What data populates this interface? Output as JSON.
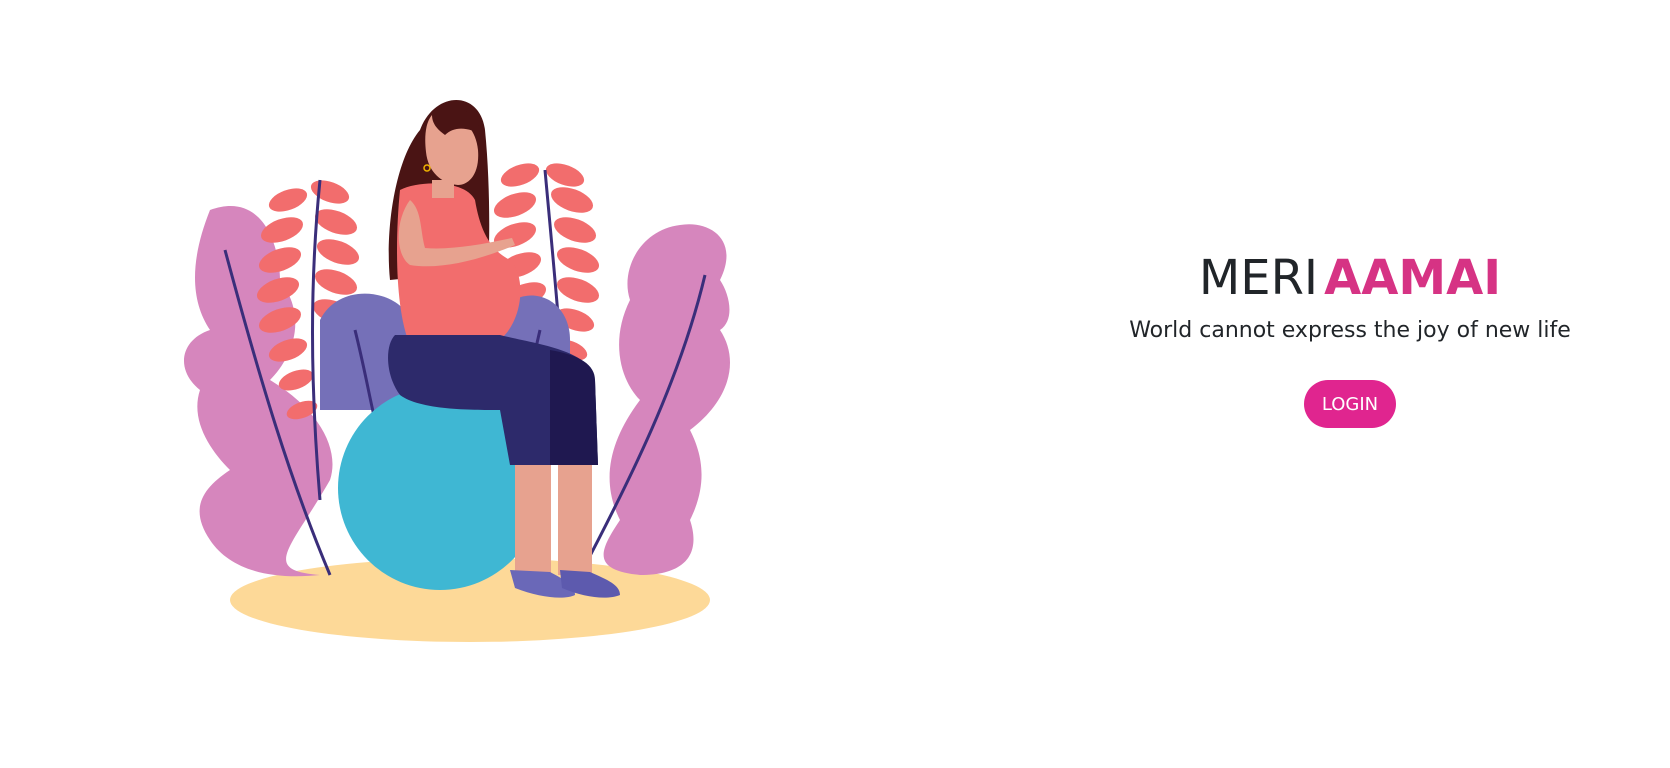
{
  "hero": {
    "title_part1": "MERI",
    "title_part2": "AAMAI",
    "tagline": "World cannot express the joy of new life",
    "login_label": "LOGIN"
  },
  "colors": {
    "accent": "#e0258f",
    "accent_text": "#d63384",
    "text": "#212529",
    "background": "#ffffff"
  },
  "illustration": {
    "subject": "pregnant-woman-on-exercise-ball-icon"
  }
}
